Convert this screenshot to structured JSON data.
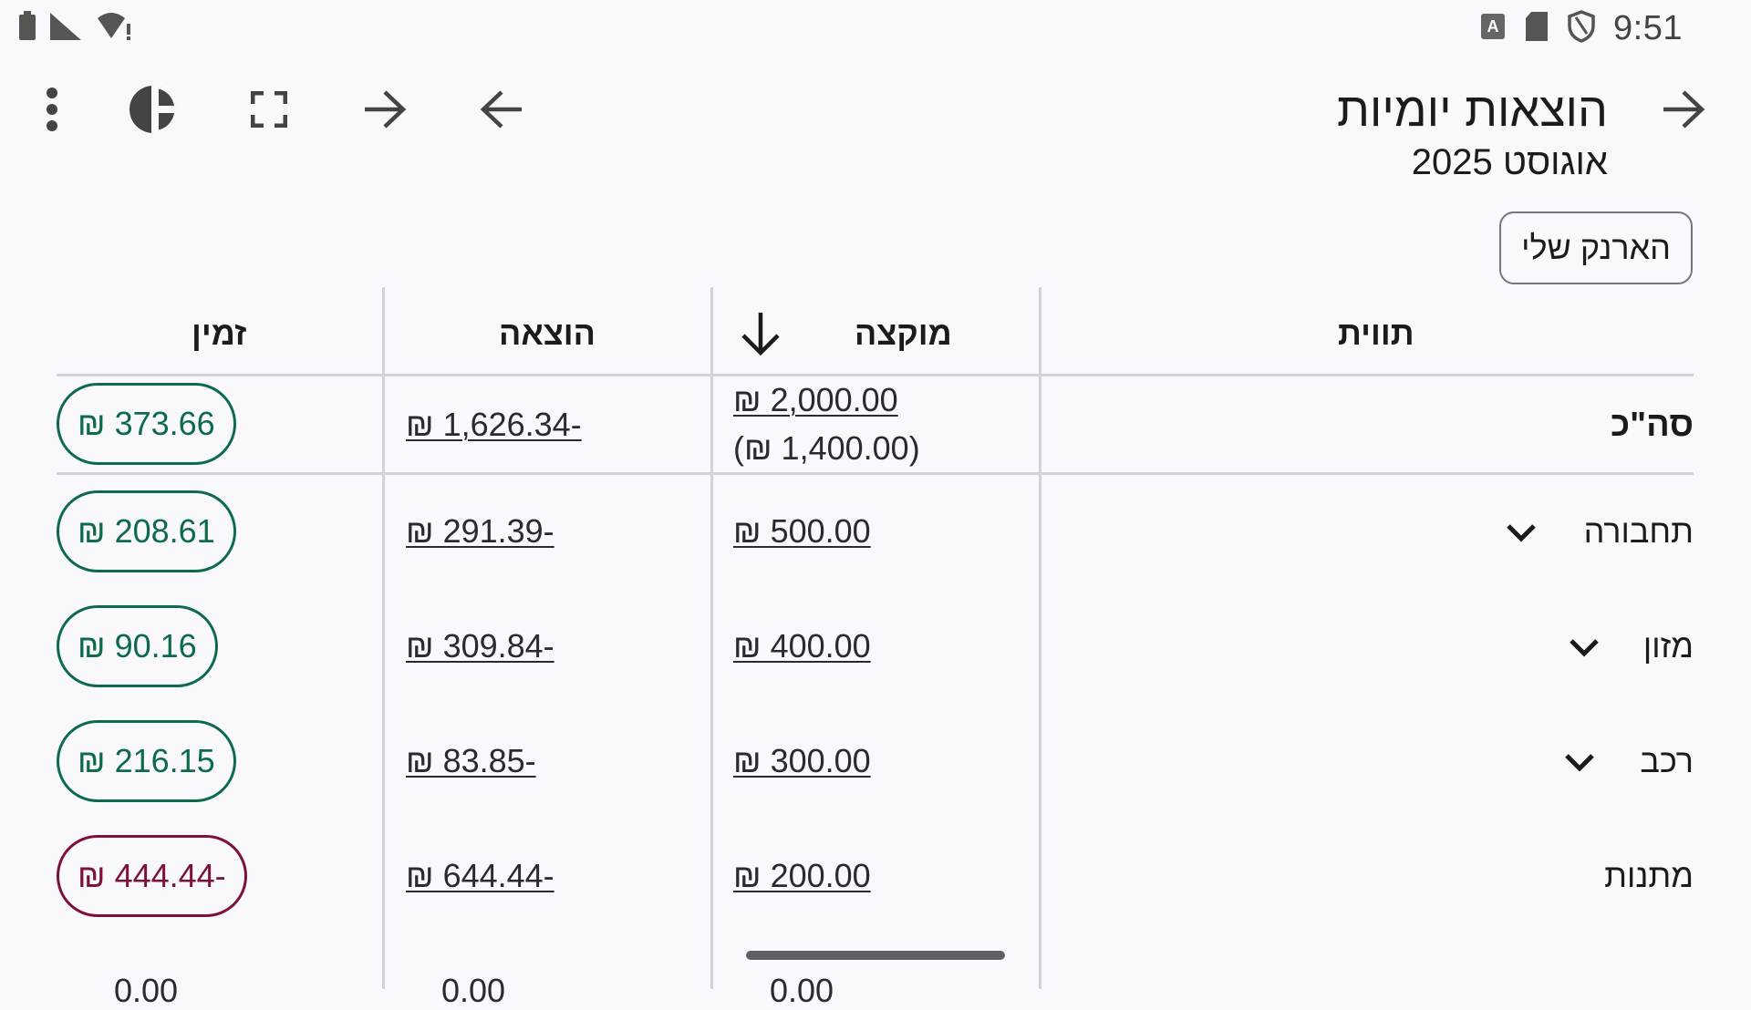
{
  "status_bar": {
    "time": "9:51",
    "left_icons": [
      "battery-icon",
      "signal-icon",
      "wifi-alert-icon"
    ],
    "right_icons": [
      "keyboard-a-icon",
      "sd-card-icon",
      "shield-icon"
    ]
  },
  "app_bar": {
    "title": "הוצאות יומיות",
    "subtitle": "אוגוסט 2025",
    "icons": [
      "more-vert-icon",
      "pie-chart-icon",
      "fullscreen-icon",
      "forward-arrow-icon",
      "back-arrow-icon",
      "nav-back-icon"
    ]
  },
  "wallet_chip": {
    "label": "הארנק שלי"
  },
  "table": {
    "headers": {
      "label": "תווית",
      "allocated": "מוקצה",
      "expense": "הוצאה",
      "available": "זמין"
    },
    "sort_icon": "arrow-down-icon",
    "total": {
      "label": "סה\"כ",
      "allocated": "₪ 2,000.00",
      "allocated_sub": "(₪ 1,400.00)",
      "expense": "₪ 1,626.34-",
      "available": "₪ 373.66"
    },
    "rows": [
      {
        "label": "תחבורה",
        "allocated": "₪ 500.00",
        "expense": "₪ 291.39-",
        "available": "₪ 208.61",
        "status": "positive",
        "expandable": true
      },
      {
        "label": "מזון",
        "allocated": "₪ 400.00",
        "expense": "₪ 309.84-",
        "available": "₪ 90.16",
        "status": "positive",
        "expandable": true
      },
      {
        "label": "רכב",
        "allocated": "₪ 300.00",
        "expense": "₪ 83.85-",
        "available": "₪ 216.15",
        "status": "positive",
        "expandable": true
      },
      {
        "label": "מתנות",
        "allocated": "₪ 200.00",
        "expense": "₪ 644.44-",
        "available": "₪ 444.44-",
        "status": "negative",
        "expandable": false
      }
    ],
    "partial_row": {
      "allocated": "0.00",
      "expense": "0.00",
      "available": "0.00"
    }
  },
  "colors": {
    "background": "#f9f9fd",
    "positive": "#0e6b4a",
    "negative": "#7d1235",
    "divider": "#d2d3da"
  }
}
